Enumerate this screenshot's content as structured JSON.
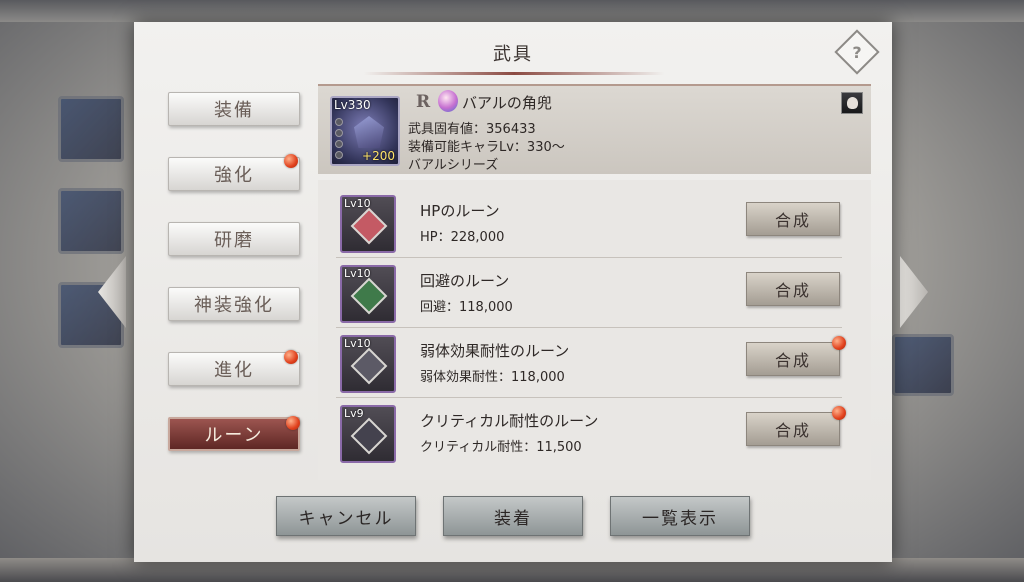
{
  "dialog": {
    "title": "武具",
    "help_icon": "question-diamond-icon"
  },
  "tabs": [
    {
      "label": "装備",
      "active": false,
      "badge": false
    },
    {
      "label": "強化",
      "active": false,
      "badge": true
    },
    {
      "label": "研磨",
      "active": false,
      "badge": false
    },
    {
      "label": "神装強化",
      "active": false,
      "badge": false
    },
    {
      "label": "進化",
      "active": false,
      "badge": true
    },
    {
      "label": "ルーン",
      "active": true,
      "badge": true
    }
  ],
  "item": {
    "level": "Lv330",
    "plus": "+200",
    "rarity": "R",
    "name": "バアルの角兜",
    "inherent_value": "武具固有値：356433",
    "equip_level": "装備可能キャラLv：330〜",
    "series": "バアルシリーズ"
  },
  "runes": [
    {
      "level": "Lv10",
      "name": "HPのルーン",
      "stat": "HP：228,000",
      "button": "合成",
      "badge": false,
      "gem_color": "#c45a64"
    },
    {
      "level": "Lv10",
      "name": "回避のルーン",
      "stat": "回避：118,000",
      "button": "合成",
      "badge": false,
      "gem_color": "#3f7a4a"
    },
    {
      "level": "Lv10",
      "name": "弱体効果耐性のルーン",
      "stat": "弱体効果耐性：118,000",
      "button": "合成",
      "badge": true,
      "gem_color": "#5c5a66"
    },
    {
      "level": "Lv9",
      "name": "クリティカル耐性のルーン",
      "stat": "クリティカル耐性：11,500",
      "button": "合成",
      "badge": true,
      "gem_color": "#44424e"
    }
  ],
  "buttons": {
    "cancel": "キャンセル",
    "equip": "装着",
    "list_view": "一覧表示"
  },
  "colors": {
    "active_tab": "#7a3a36",
    "badge": "#e0401c"
  }
}
